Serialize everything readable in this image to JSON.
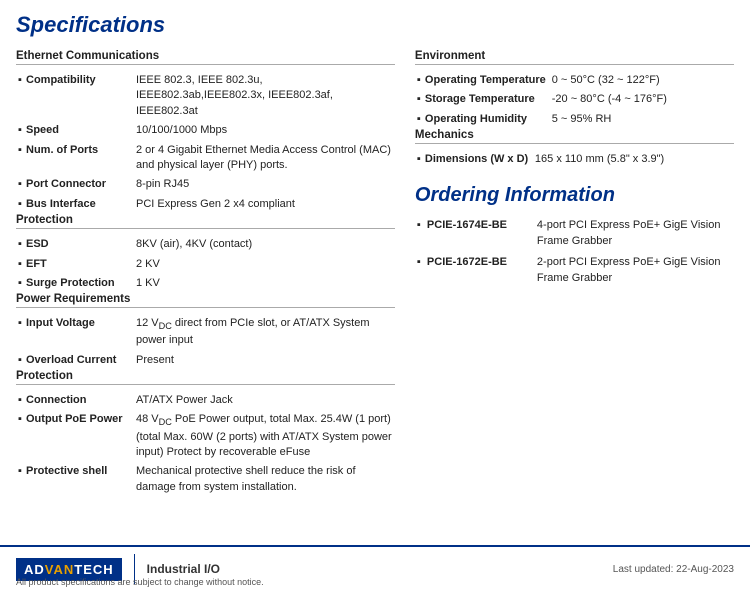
{
  "title": "Specifications",
  "left_column": {
    "sections": [
      {
        "id": "ethernet",
        "title": "Ethernet Communications",
        "rows": [
          {
            "label": "Compatibility",
            "value": "IEEE 802.3, IEEE 802.3u, IEEE802.3ab,IEEE802.3x, IEEE802.3af, IEEE802.3at"
          },
          {
            "label": "Speed",
            "value": "10/100/1000 Mbps"
          },
          {
            "label": "Num. of Ports",
            "value": "2 or 4 Gigabit Ethernet Media Access Control (MAC) and physical layer (PHY) ports."
          },
          {
            "label": "Port Connector",
            "value": "8-pin RJ45"
          },
          {
            "label": "Bus Interface",
            "value": "PCI Express Gen 2 x4 compliant"
          }
        ]
      },
      {
        "id": "protection1",
        "title": "Protection",
        "rows": [
          {
            "label": "ESD",
            "value": "8KV (air), 4KV (contact)"
          },
          {
            "label": "EFT",
            "value": "2 KV"
          },
          {
            "label": "Surge Protection",
            "value": "1 KV"
          }
        ]
      },
      {
        "id": "power",
        "title": "Power Requirements",
        "rows": [
          {
            "label": "Input Voltage",
            "value": "12 VDC direct from PCIe slot, or AT/ATX System power input"
          },
          {
            "label": "Overload Current",
            "value": "Present"
          }
        ]
      },
      {
        "id": "protection2",
        "title": "Protection",
        "rows": [
          {
            "label": "Connection",
            "value": "AT/ATX Power Jack"
          },
          {
            "label": "Output PoE Power",
            "value": "48 VDC PoE Power output, total Max. 25.4W (1 port) (total Max. 60W (2 ports) with AT/ATX System power input) Protect by recoverable eFuse"
          },
          {
            "label": "Protective shell",
            "value": "Mechanical protective shell reduce the risk of damage from system installation."
          }
        ]
      }
    ]
  },
  "right_column": {
    "environment": {
      "title": "Environment",
      "rows": [
        {
          "label": "Operating Temperature",
          "value": "0 ~ 50°C (32 ~ 122°F)"
        },
        {
          "label": "Storage Temperature",
          "value": "-20 ~ 80°C (-4 ~ 176°F)"
        },
        {
          "label": "Operating Humidity",
          "value": "5 ~ 95% RH"
        }
      ]
    },
    "mechanics": {
      "title": "Mechanics",
      "rows": [
        {
          "label": "Dimensions (W x D)",
          "value": "165 x 110 mm (5.8\" x 3.9\")"
        }
      ]
    },
    "ordering": {
      "title": "Ordering Information",
      "items": [
        {
          "model": "PCIE-1674E-BE",
          "description": "4-port PCI Express PoE+ GigE Vision Frame Grabber"
        },
        {
          "model": "PCIE-1672E-BE",
          "description": "2-port PCI Express PoE+ GigE Vision Frame Grabber"
        }
      ]
    }
  },
  "footer": {
    "logo_ad": "AD",
    "logo_van": "VAN",
    "logo_tech": "TECH",
    "label": "Industrial I/O",
    "disclaimer": "All product specifications are subject to change without notice.",
    "last_updated": "Last updated: 22-Aug-2023"
  },
  "input_voltage_sup": "DC"
}
